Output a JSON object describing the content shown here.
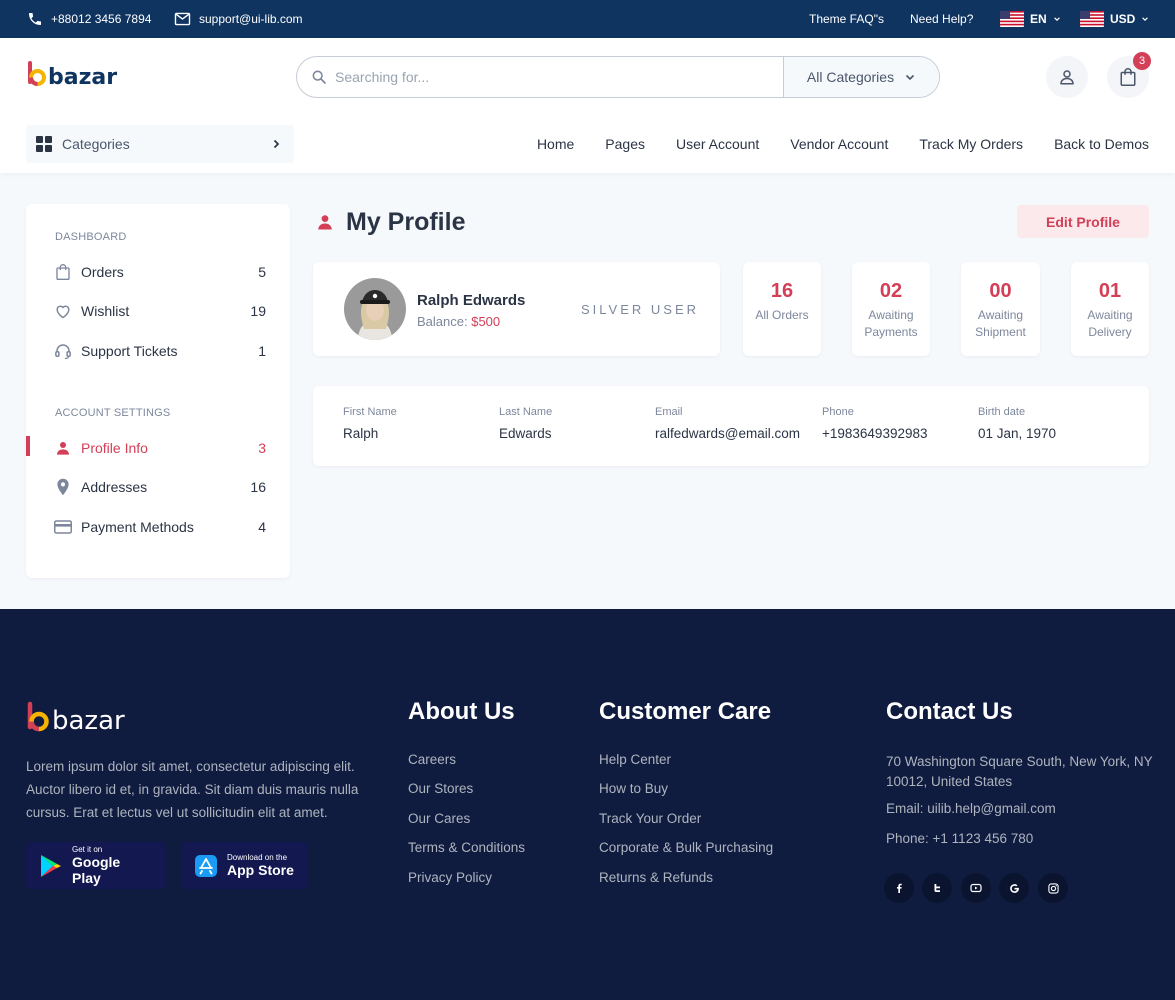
{
  "topbar": {
    "phone": "+88012 3456 7894",
    "email": "support@ui-lib.com",
    "links": [
      "Theme FAQ\"s",
      "Need Help?"
    ],
    "language": "EN",
    "currency": "USD"
  },
  "header": {
    "logo": "bazar",
    "search_placeholder": "Searching for...",
    "category_select": "All Categories",
    "cart_count": "3",
    "categories_label": "Categories",
    "nav": [
      "Home",
      "Pages",
      "User Account",
      "Vendor Account",
      "Track My Orders",
      "Back to Demos"
    ]
  },
  "sidebar": {
    "dashboard_title": "DASHBOARD",
    "dashboard_items": [
      {
        "label": "Orders",
        "count": "5",
        "icon": "shopping-bag-icon"
      },
      {
        "label": "Wishlist",
        "count": "19",
        "icon": "heart-icon"
      },
      {
        "label": "Support Tickets",
        "count": "1",
        "icon": "headset-icon"
      }
    ],
    "account_title": "ACCOUNT SETTINGS",
    "account_items": [
      {
        "label": "Profile Info",
        "count": "3",
        "icon": "person-icon",
        "active": true
      },
      {
        "label": "Addresses",
        "count": "16",
        "icon": "location-pin-icon"
      },
      {
        "label": "Payment Methods",
        "count": "4",
        "icon": "credit-card-icon"
      }
    ]
  },
  "profile": {
    "title": "My Profile",
    "edit_label": "Edit Profile",
    "name": "Ralph Edwards",
    "balance_label": "Balance:",
    "balance_amount": "$500",
    "tier": "SILVER USER",
    "stats": [
      {
        "num": "16",
        "label": "All Orders"
      },
      {
        "num": "02",
        "label": "Awaiting Payments"
      },
      {
        "num": "00",
        "label": "Awaiting Shipment"
      },
      {
        "num": "01",
        "label": "Awaiting Delivery"
      }
    ],
    "fields": [
      {
        "key": "First Name",
        "value": "Ralph"
      },
      {
        "key": "Last Name",
        "value": "Edwards"
      },
      {
        "key": "Email",
        "value": "ralfedwards@email.com"
      },
      {
        "key": "Phone",
        "value": "+1983649392983"
      },
      {
        "key": "Birth date",
        "value": "01 Jan, 1970"
      }
    ]
  },
  "footer": {
    "logo": "bazar",
    "description": "Lorem ipsum dolor sit amet, consectetur adipiscing elit. Auctor libero id et, in gravida. Sit diam duis mauris nulla cursus. Erat et lectus vel ut sollicitudin elit at amet.",
    "google_play": {
      "line1": "Get it on",
      "line2": "Google Play"
    },
    "app_store": {
      "line1": "Download on the",
      "line2": "App Store"
    },
    "about_title": "About Us",
    "about_links": [
      "Careers",
      "Our Stores",
      "Our Cares",
      "Terms & Conditions",
      "Privacy Policy"
    ],
    "care_title": "Customer Care",
    "care_links": [
      "Help Center",
      "How to Buy",
      "Track Your Order",
      "Corporate & Bulk Purchasing",
      "Returns & Refunds"
    ],
    "contact_title": "Contact Us",
    "address": "70 Washington Square South, New York, NY 10012, United States",
    "contact_email": "Email: uilib.help@gmail.com",
    "contact_phone": "Phone: +1 1123 456 780",
    "social_icons": [
      "facebook-icon",
      "twitter-icon",
      "youtube-icon",
      "google-icon",
      "instagram-icon"
    ]
  },
  "colors": {
    "primary": "#d23f57",
    "topbar": "#0f3460",
    "footer": "#0f1b3f"
  }
}
